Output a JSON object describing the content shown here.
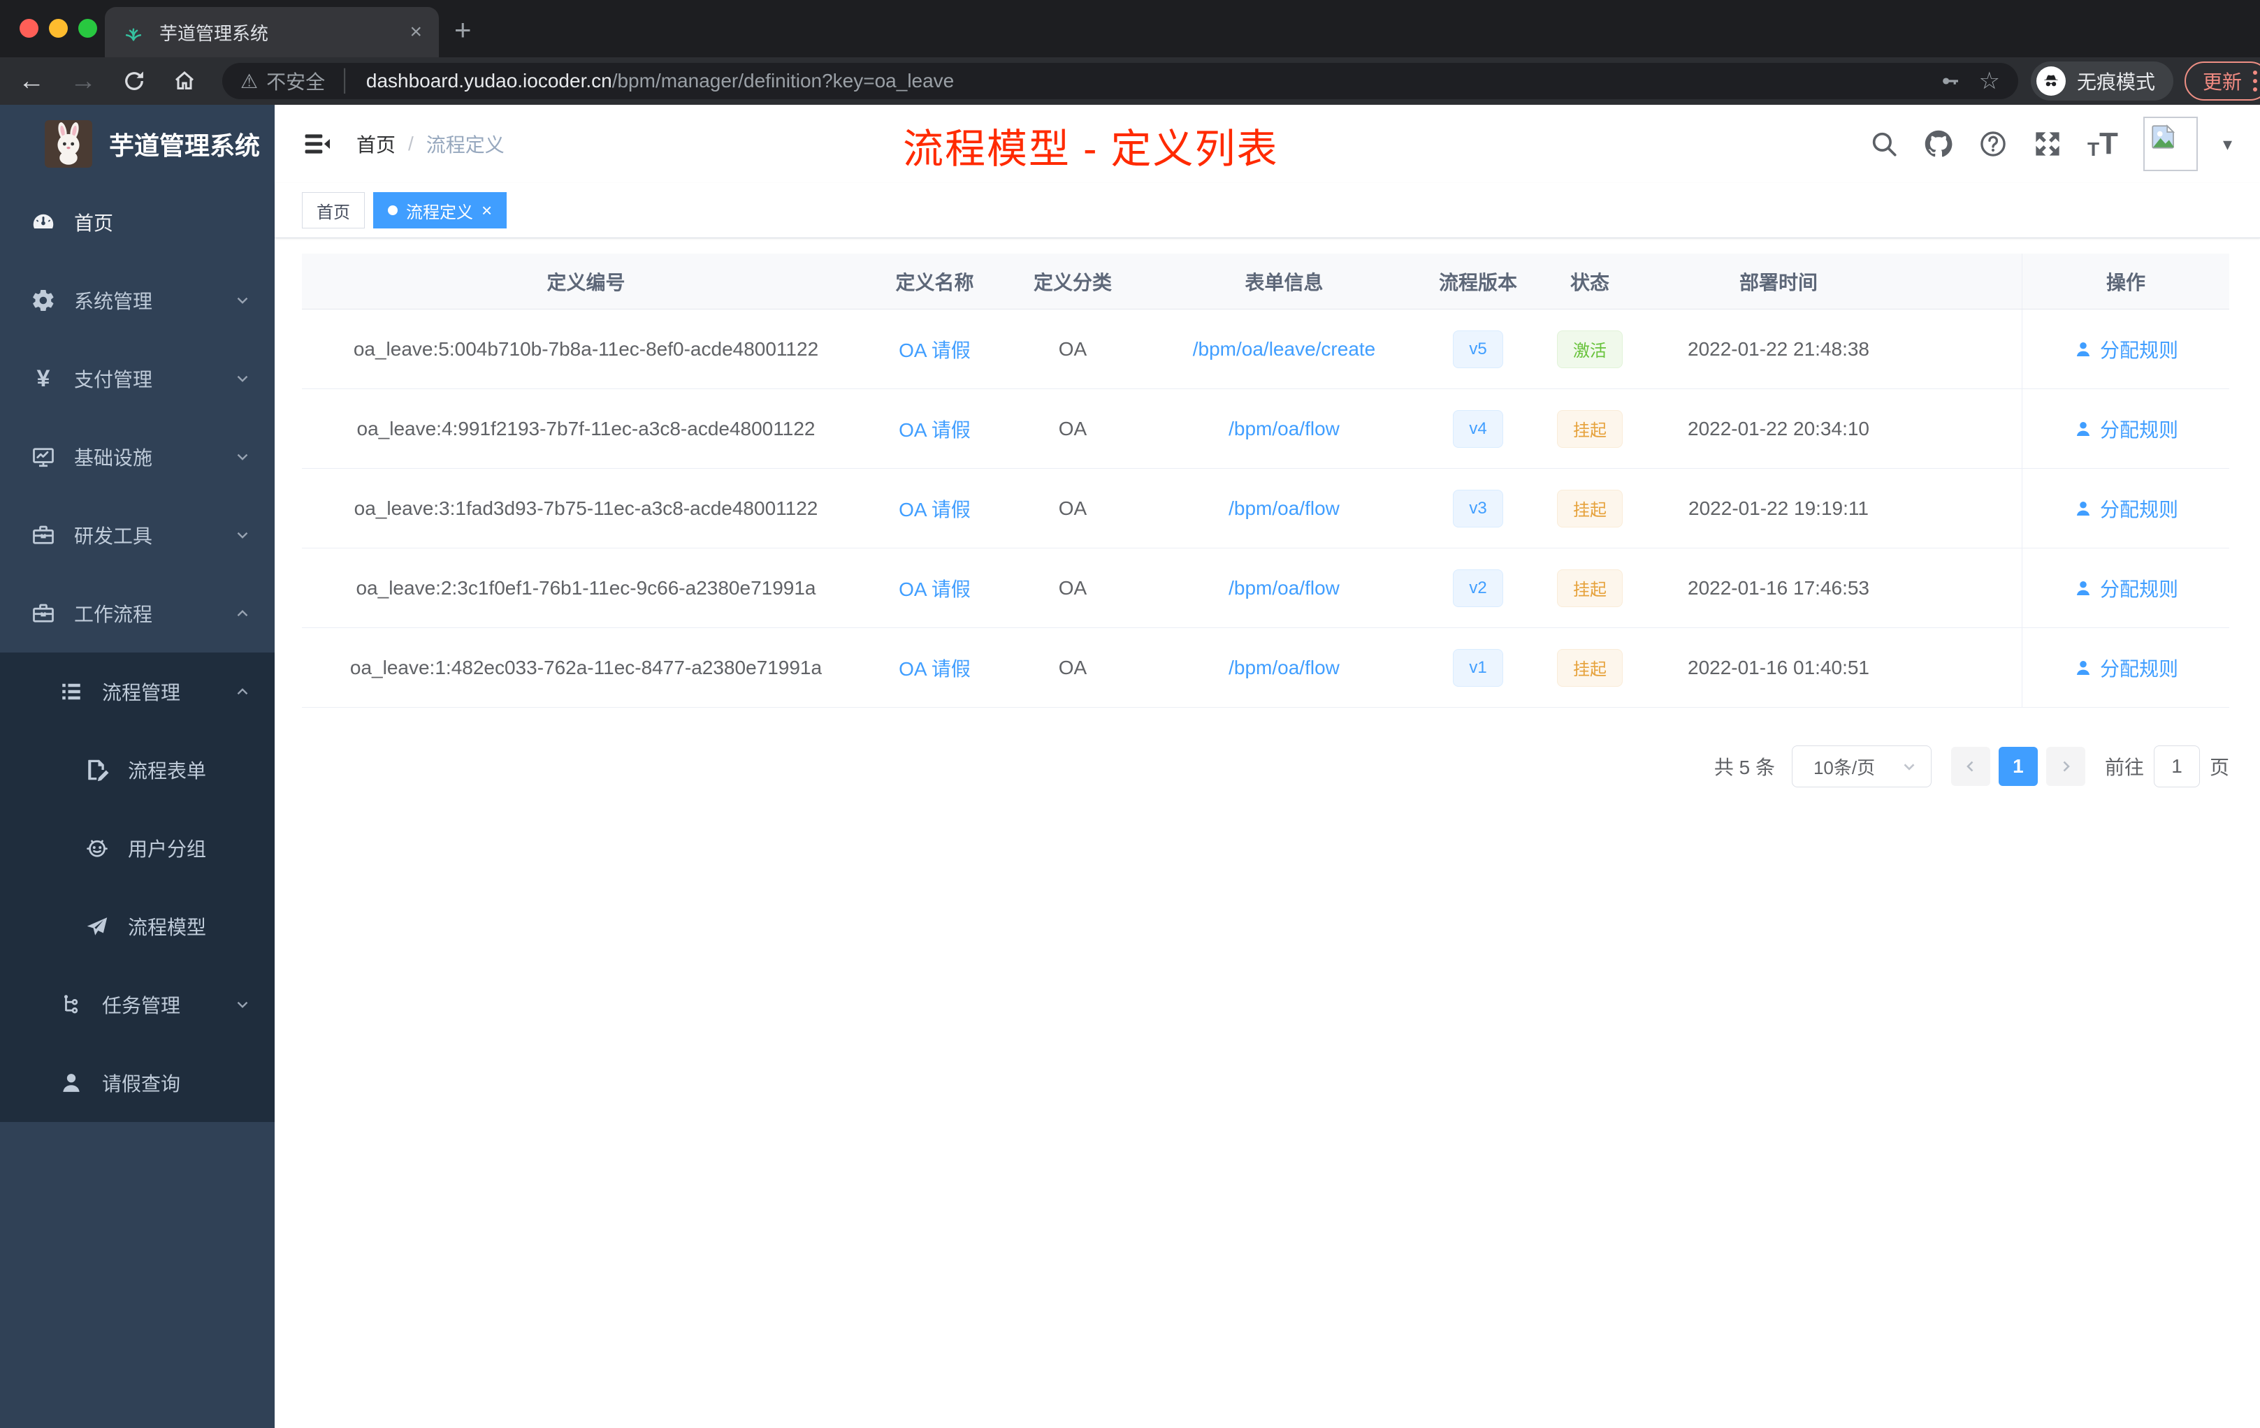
{
  "browser": {
    "tab_title": "芋道管理系统",
    "new_tab": "+",
    "close_tab": "×",
    "security_label": "不安全",
    "url_domain": "dashboard.yudao.iocoder.cn",
    "url_path": "/bpm/manager/definition?key=oa_leave",
    "incognito_label": "无痕模式",
    "update_label": "更新"
  },
  "sidebar": {
    "logo_title": "芋道管理系统",
    "menu": [
      {
        "label": "首页",
        "icon": "dashboard",
        "depth": 1,
        "bright": true
      },
      {
        "label": "系统管理",
        "icon": "gear",
        "depth": 1,
        "chevron": "down"
      },
      {
        "label": "支付管理",
        "icon": "yen",
        "depth": 1,
        "chevron": "down"
      },
      {
        "label": "基础设施",
        "icon": "monitor",
        "depth": 1,
        "chevron": "down"
      },
      {
        "label": "研发工具",
        "icon": "toolbox",
        "depth": 1,
        "chevron": "down"
      },
      {
        "label": "工作流程",
        "icon": "briefcase",
        "depth": 1,
        "chevron": "up"
      },
      {
        "label": "流程管理",
        "icon": "list",
        "depth": 2,
        "chevron": "up"
      },
      {
        "label": "流程表单",
        "icon": "form",
        "depth": 3
      },
      {
        "label": "用户分组",
        "icon": "robot",
        "depth": 3
      },
      {
        "label": "流程模型",
        "icon": "send",
        "depth": 3
      },
      {
        "label": "任务管理",
        "icon": "tree",
        "depth": 2,
        "chevron": "down"
      },
      {
        "label": "请假查询",
        "icon": "user",
        "depth": 2
      }
    ]
  },
  "header": {
    "breadcrumb_home": "首页",
    "breadcrumb_sep": "/",
    "breadcrumb_current": "流程定义",
    "annotation": "流程模型 - 定义列表",
    "font_small": "T",
    "font_big": "T"
  },
  "tags": [
    {
      "label": "首页",
      "active": false
    },
    {
      "label": "流程定义",
      "active": true,
      "close": "×"
    }
  ],
  "table": {
    "columns": [
      "定义编号",
      "定义名称",
      "定义分类",
      "表单信息",
      "流程版本",
      "状态",
      "部署时间",
      "操作"
    ],
    "action_label": "分配规则",
    "rows": [
      {
        "id": "oa_leave:5:004b710b-7b8a-11ec-8ef0-acde48001122",
        "name": "OA 请假",
        "category": "OA",
        "form": "/bpm/oa/leave/create",
        "version": "v5",
        "status": "激活",
        "status_type": "success",
        "deployed": "2022-01-22 21:48:38"
      },
      {
        "id": "oa_leave:4:991f2193-7b7f-11ec-a3c8-acde48001122",
        "name": "OA 请假",
        "category": "OA",
        "form": "/bpm/oa/flow",
        "version": "v4",
        "status": "挂起",
        "status_type": "warning",
        "deployed": "2022-01-22 20:34:10"
      },
      {
        "id": "oa_leave:3:1fad3d93-7b75-11ec-a3c8-acde48001122",
        "name": "OA 请假",
        "category": "OA",
        "form": "/bpm/oa/flow",
        "version": "v3",
        "status": "挂起",
        "status_type": "warning",
        "deployed": "2022-01-22 19:19:11"
      },
      {
        "id": "oa_leave:2:3c1f0ef1-76b1-11ec-9c66-a2380e71991a",
        "name": "OA 请假",
        "category": "OA",
        "form": "/bpm/oa/flow",
        "version": "v2",
        "status": "挂起",
        "status_type": "warning",
        "deployed": "2022-01-16 17:46:53"
      },
      {
        "id": "oa_leave:1:482ec033-762a-11ec-8477-a2380e71991a",
        "name": "OA 请假",
        "category": "OA",
        "form": "/bpm/oa/flow",
        "version": "v1",
        "status": "挂起",
        "status_type": "warning",
        "deployed": "2022-01-16 01:40:51"
      }
    ]
  },
  "pagination": {
    "total": "共 5 条",
    "page_size": "10条/页",
    "page": "1",
    "goto_label": "前往",
    "goto_value": "1",
    "unit_label": "页"
  },
  "colors": {
    "accent": "#409eff",
    "annotation_red": "#ff2a00",
    "tag_success": "#67c23a",
    "tag_warning": "#e6a23c",
    "sidebar_bg": "#304156",
    "submenu_bg": "#1f2d3d"
  }
}
